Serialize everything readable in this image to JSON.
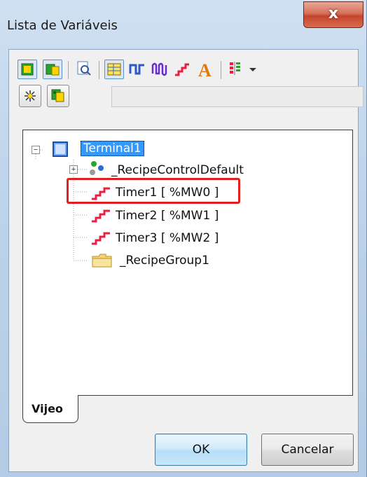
{
  "window": {
    "title": "Lista de Variáveis",
    "close_label": "x"
  },
  "toolbar": {
    "buttons": [
      "terminal-icon",
      "terminal-group-icon",
      "zoom-page-icon",
      "grid-view-icon",
      "pulse-icon",
      "wave-icon",
      "timer-icon",
      "text-icon",
      "columns-icon",
      "dropdown-arrow-icon"
    ],
    "secondary_buttons": [
      "sparkle-icon",
      "recipe-icon"
    ],
    "search_value": ""
  },
  "tree": {
    "root": {
      "label": "Terminal1",
      "expander": "−"
    },
    "children": [
      {
        "label": "_RecipeControlDefault",
        "icon": "recipe-control-icon",
        "expander": "+"
      },
      {
        "label": "Timer1 [ %MW0 ]",
        "icon": "timer-icon"
      },
      {
        "label": "Timer2 [ %MW1 ]",
        "icon": "timer-icon"
      },
      {
        "label": "Timer3 [ %MW2 ]",
        "icon": "timer-icon"
      },
      {
        "label": "_RecipeGroup1",
        "icon": "folder-icon"
      }
    ]
  },
  "tabs": [
    {
      "label": "Vijeo"
    }
  ],
  "buttons": {
    "ok_label": "OK",
    "cancel_label": "Cancelar"
  },
  "colors": {
    "selection": "#3399ff",
    "highlight": "#e02020",
    "timer_icon": "#e82040"
  }
}
